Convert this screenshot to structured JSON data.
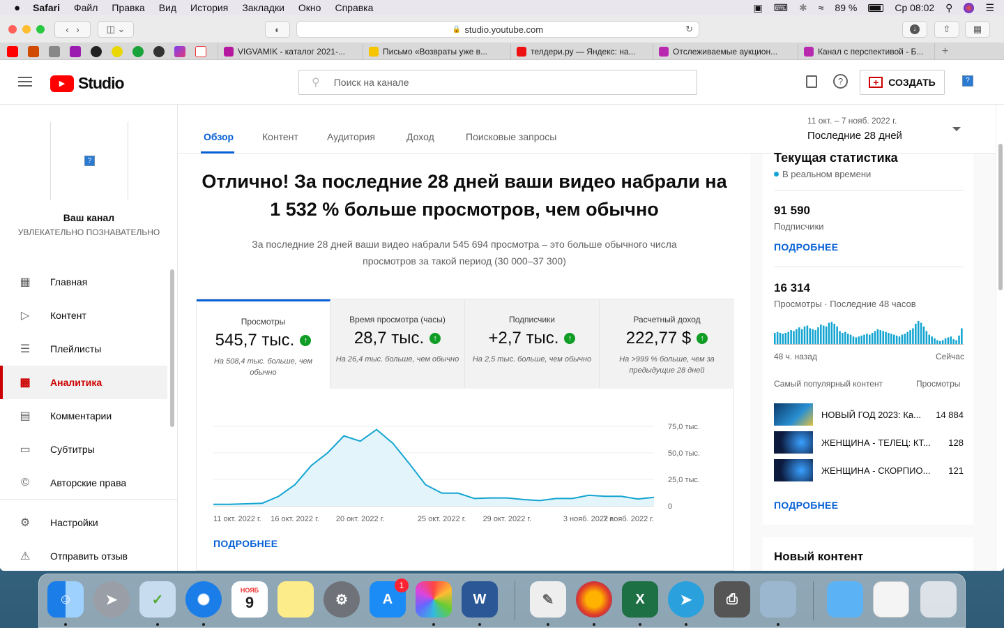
{
  "menubar": {
    "app": "Safari",
    "items": [
      "Файл",
      "Правка",
      "Вид",
      "История",
      "Закладки",
      "Окно",
      "Справка"
    ],
    "battery": "89 %",
    "clock": "Ср 08:02"
  },
  "browser": {
    "url": "studio.youtube.com",
    "tabs": [
      {
        "label": "VIGVAMIK - каталог 2021-...",
        "color": "#b5179e"
      },
      {
        "label": "Письмо «Возвраты уже в...",
        "color": "#f6c400"
      },
      {
        "label": "телдери.ру — Яндекс: на...",
        "color": "#e11"
      },
      {
        "label": "Отслеживаемые аукцион...",
        "color": "#b829b0"
      },
      {
        "label": "Канал с перспективой - Б...",
        "color": "#b829b0"
      }
    ]
  },
  "header": {
    "logo": "Studio",
    "search_placeholder": "Поиск на канале",
    "create_label": "СОЗДАТЬ"
  },
  "sidebar": {
    "channel_title": "Ваш канал",
    "channel_name": "УВЛЕКАТЕЛЬНО ПОЗНАВАТЕЛЬНО",
    "items": [
      {
        "label": "Главная",
        "icon": "dashboard-icon"
      },
      {
        "label": "Контент",
        "icon": "content-icon"
      },
      {
        "label": "Плейлисты",
        "icon": "playlist-icon"
      },
      {
        "label": "Аналитика",
        "icon": "analytics-icon"
      },
      {
        "label": "Комментарии",
        "icon": "comments-icon"
      },
      {
        "label": "Субтитры",
        "icon": "subtitles-icon"
      },
      {
        "label": "Авторские права",
        "icon": "copyright-icon"
      }
    ],
    "bottom": [
      {
        "label": "Настройки",
        "icon": "gear-icon"
      },
      {
        "label": "Отправить отзыв",
        "icon": "feedback-icon"
      }
    ]
  },
  "subtabs": [
    "Обзор",
    "Контент",
    "Аудитория",
    "Доход",
    "Поисковые запросы"
  ],
  "period": {
    "range": "11 окт. – 7 нояб. 2022 г.",
    "label": "Последние 28 дней"
  },
  "headline": "Отлично! За последние 28 дней ваши видео набрали на 1 532 % больше просмотров, чем обычно",
  "subtext": "За последние 28 дней ваши видео набрали 545 694 просмотра – это больше обычного числа просмотров за такой период (30 000–37 300)",
  "metrics": [
    {
      "title": "Просмотры",
      "value": "545,7 тыс.",
      "compare": "На 508,4 тыс. больше, чем обычно"
    },
    {
      "title": "Время просмотра (часы)",
      "value": "28,7 тыс.",
      "compare": "На 26,4 тыс. больше, чем обычно"
    },
    {
      "title": "Подписчики",
      "value": "+2,7 тыс.",
      "compare": "На 2,5 тыс. больше, чем обычно"
    },
    {
      "title": "Расчетный доход",
      "value": "222,77 $",
      "compare": "На >999 % больше, чем за предыдущие 28 дней"
    }
  ],
  "more": "ПОДРОБНЕЕ",
  "chart_data": {
    "type": "area",
    "x": [
      "11 окт.",
      "12 окт.",
      "13 окт.",
      "14 окт.",
      "15 окт.",
      "16 окт.",
      "17 окт.",
      "18 окт.",
      "19 окт.",
      "20 окт.",
      "21 окт.",
      "22 окт.",
      "23 окт.",
      "24 окт.",
      "25 окт.",
      "26 окт.",
      "27 окт.",
      "28 окт.",
      "29 окт.",
      "30 окт.",
      "31 окт.",
      "1 нояб.",
      "2 нояб.",
      "3 нояб.",
      "4 нояб.",
      "5 нояб.",
      "6 нояб.",
      "7 нояб."
    ],
    "values": [
      1500,
      1500,
      2000,
      2500,
      9000,
      20000,
      38000,
      50000,
      66000,
      61000,
      72000,
      59000,
      40000,
      20000,
      12000,
      12000,
      7000,
      7500,
      7500,
      6000,
      5000,
      7000,
      7000,
      10000,
      9000,
      9000,
      6500,
      8000
    ],
    "ylim": [
      0,
      75000
    ],
    "yticks": [
      "75,0 тыс.",
      "50,0 тыс.",
      "25,0 тыс.",
      "0"
    ],
    "xticks": [
      "11 окт. 2022 г.",
      "16 окт. 2022 г.",
      "20 окт. 2022 г.",
      "25 окт. 2022 г.",
      "29 окт. 2022 г.",
      "3 нояб. 2022 г.",
      "7 нояб. 2022 г."
    ],
    "color": "#12a4d1"
  },
  "realtime": {
    "title": "Текущая статистика",
    "live": "В реальном времени",
    "subs_value": "91 590",
    "subs_label": "Подписчики",
    "more": "ПОДРОБНЕЕ",
    "views_value": "16 314",
    "views_label": "Просмотры · Последние 48 часов",
    "left_label": "48 ч. назад",
    "right_label": "Сейчас",
    "bars": [
      13,
      14,
      13,
      12,
      13,
      14,
      16,
      15,
      17,
      19,
      17,
      20,
      21,
      18,
      17,
      16,
      19,
      22,
      21,
      20,
      24,
      25,
      23,
      20,
      15,
      13,
      14,
      12,
      11,
      9,
      8,
      9,
      10,
      11,
      12,
      11,
      13,
      15,
      17,
      16,
      15,
      14,
      13,
      12,
      11,
      10,
      9,
      11,
      12,
      14,
      16,
      18,
      23,
      26,
      24,
      20,
      15,
      11,
      9,
      7,
      5,
      4,
      5,
      7,
      8,
      9,
      6,
      5,
      10,
      18
    ]
  },
  "top_content": {
    "header_left": "Самый популярный контент",
    "header_right": "Просмотры",
    "items": [
      {
        "title": "НОВЫЙ ГОД 2023: Ка...",
        "views": "14 884"
      },
      {
        "title": "ЖЕНЩИНА - ТЕЛЕЦ: КТ...",
        "views": "128"
      },
      {
        "title": "ЖЕНЩИНА - СКОРПИО...",
        "views": "121"
      }
    ]
  },
  "new_content": {
    "title": "Новый контент"
  }
}
